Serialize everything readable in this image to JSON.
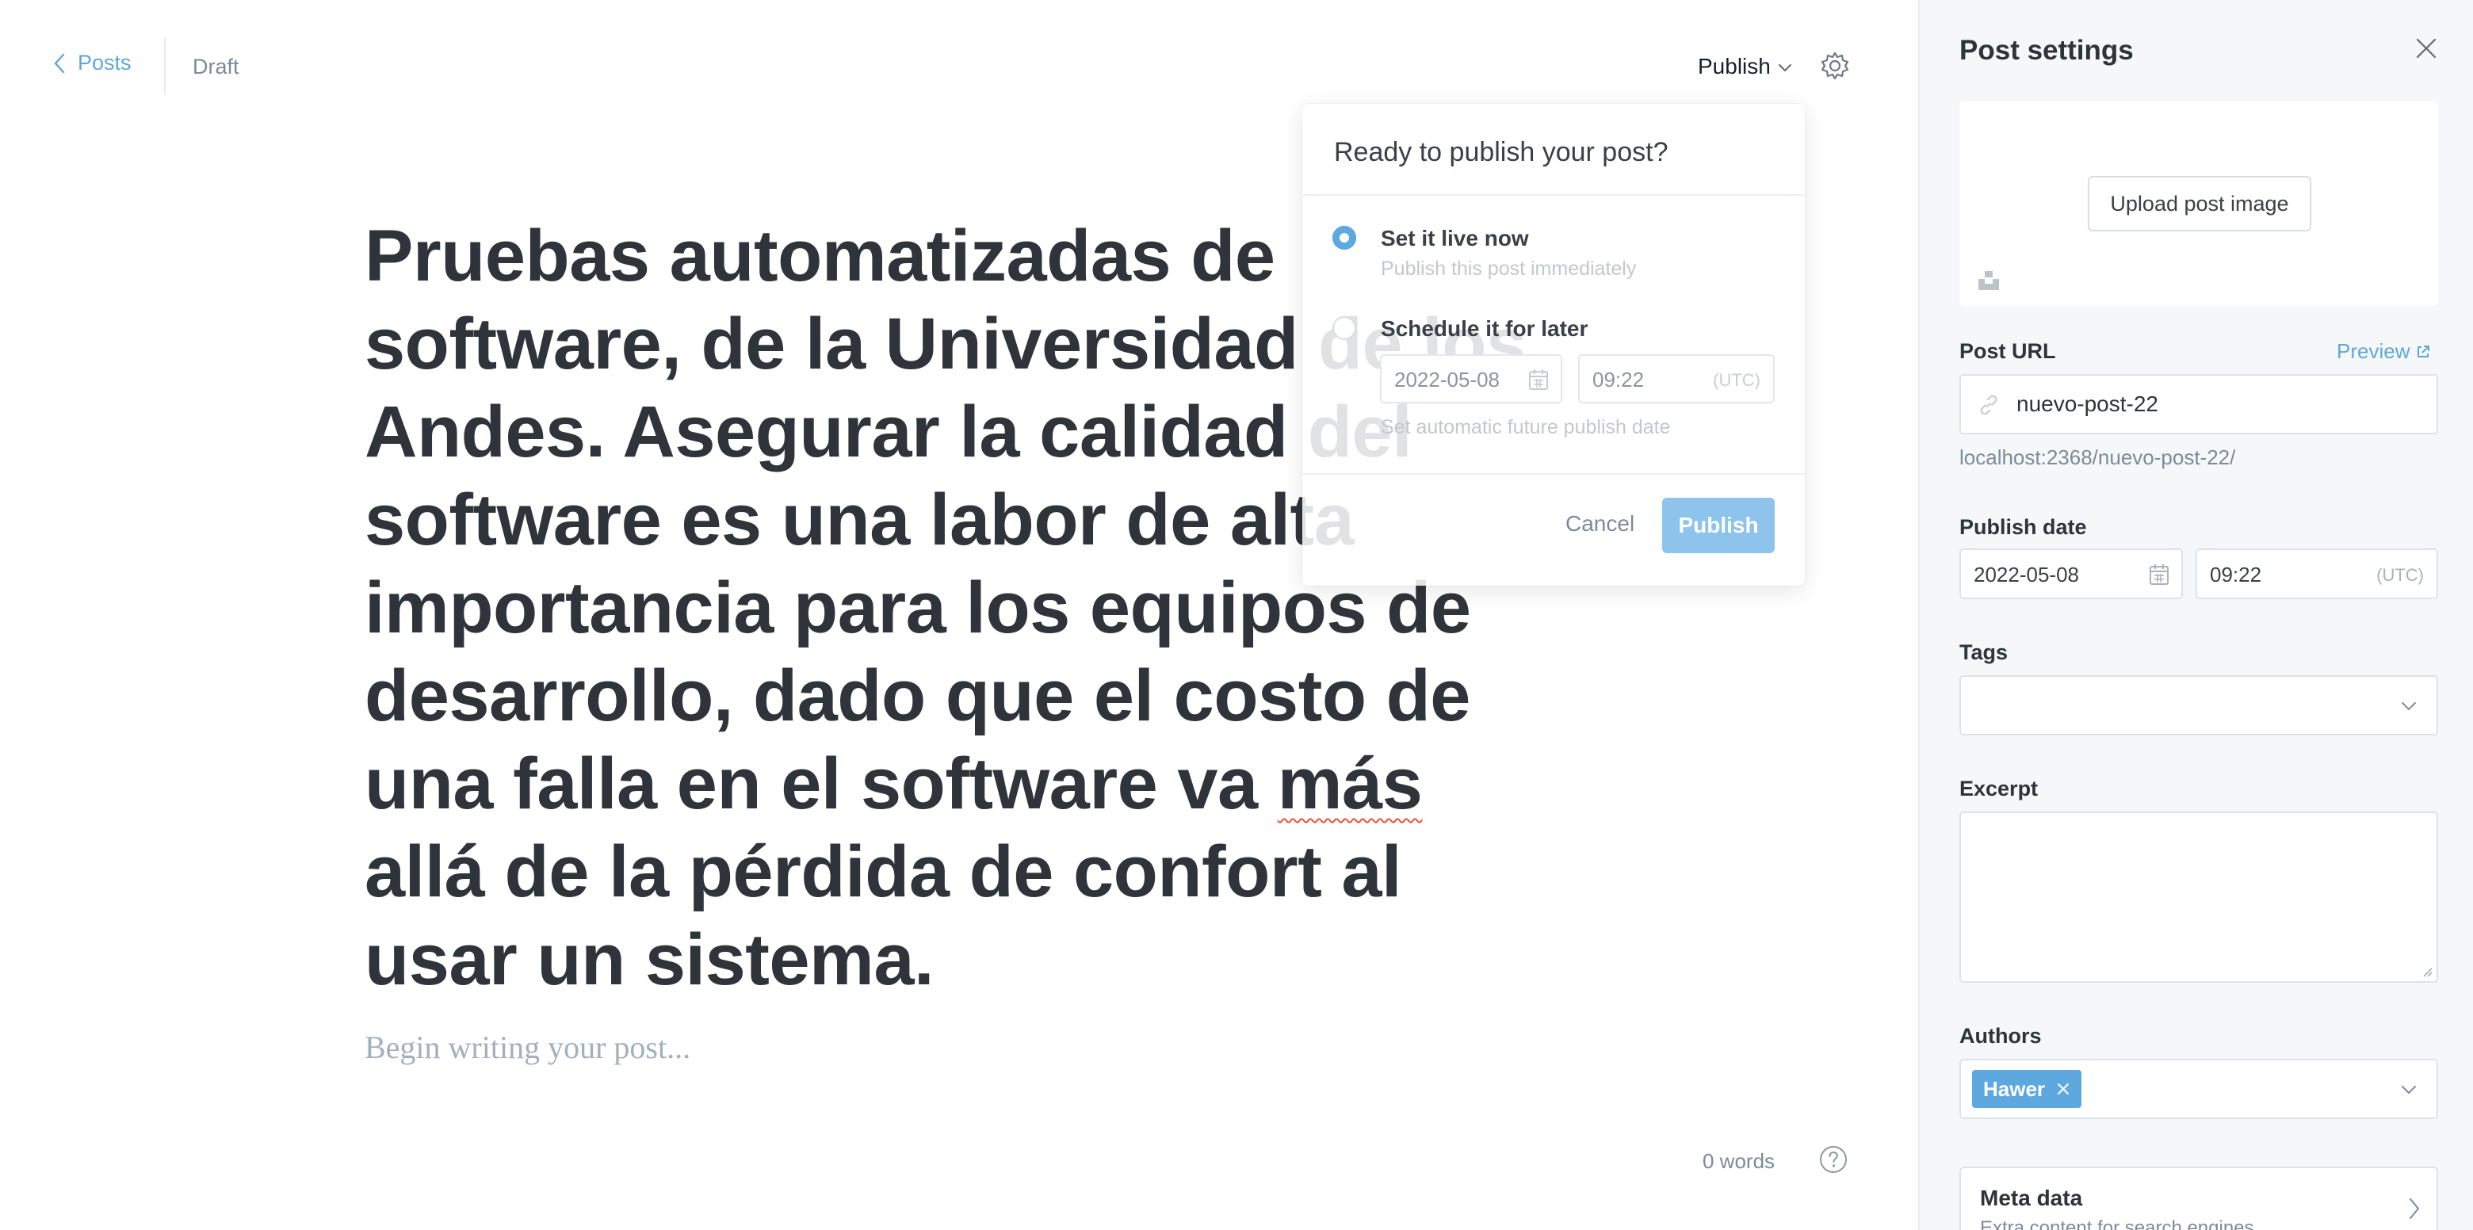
{
  "header": {
    "back_label": "Posts",
    "status": "Draft",
    "publish_label": "Publish"
  },
  "editor": {
    "title_before": "Pruebas automatizadas de software, de la Universidad de los Andes. Asegurar la calidad del software es una labor de alta importancia para los equipos de desarrollo, dado que el costo de una falla en el software va ",
    "title_misspelled": "más",
    "title_after": " allá de la pérdida de confort al usar un sistema.",
    "body_placeholder": "Begin writing your post...",
    "word_count": "0 words"
  },
  "publish_menu": {
    "title": "Ready to publish your post?",
    "option_now": {
      "label": "Set it live now",
      "description": "Publish this post immediately",
      "selected": true
    },
    "option_later": {
      "label": "Schedule it for later",
      "description": "Set automatic future publish date",
      "selected": false
    },
    "date": "2022-05-08",
    "time": "09:22",
    "timezone": "(UTC)",
    "cancel_label": "Cancel",
    "publish_label": "Publish"
  },
  "settings": {
    "title": "Post settings",
    "upload_label": "Upload post image",
    "post_url": {
      "label": "Post URL",
      "preview_label": "Preview",
      "value": "nuevo-post-22",
      "full_url": "localhost:2368/nuevo-post-22/"
    },
    "publish_date": {
      "label": "Publish date",
      "date": "2022-05-08",
      "time": "09:22",
      "timezone": "(UTC)"
    },
    "tags_label": "Tags",
    "excerpt_label": "Excerpt",
    "authors": {
      "label": "Authors",
      "items": [
        "Hawer"
      ]
    },
    "meta": {
      "title": "Meta data",
      "description": "Extra content for search engines"
    }
  },
  "colors": {
    "accent": "#5ea8e0",
    "link": "#5ea8d6",
    "panel_bg": "#f6f7f8",
    "title_text": "#2e3439"
  }
}
